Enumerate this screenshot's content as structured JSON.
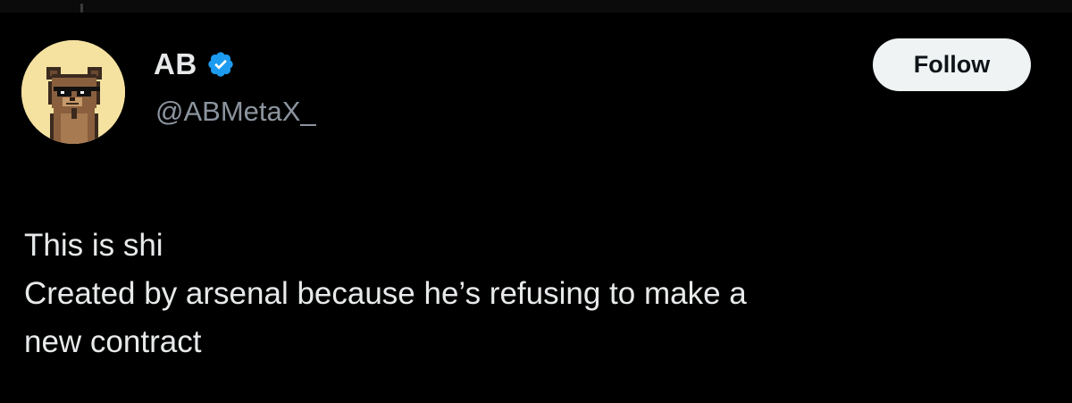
{
  "tweet": {
    "author": {
      "display_name": "AB",
      "handle": "@ABMetaX_",
      "verified": true,
      "verified_icon": "verified-badge-icon",
      "avatar_icon": "pixel-bear-sunglasses-avatar"
    },
    "follow_label": "Follow",
    "text_lines": [
      "This is shi",
      "Created by arsenal because he’s refusing to make a",
      "new contract"
    ]
  },
  "colors": {
    "background": "#000000",
    "text_primary": "#e7e9ea",
    "text_secondary": "#8b949e",
    "verified_blue": "#1d9bf0",
    "follow_button_bg": "#eff3f4",
    "follow_button_text": "#0f1419",
    "avatar_bg": "#f5e1a0"
  }
}
